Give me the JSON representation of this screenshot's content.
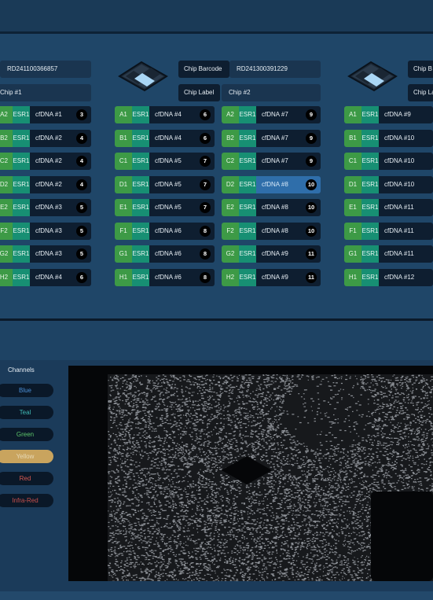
{
  "chips": [
    {
      "barcode_label": "Chip Barcode",
      "barcode": "RD241100366857",
      "label_label": "Chip Label",
      "label": "Chip #1",
      "wells": [
        {
          "pos": "A2",
          "ch": "ESR1",
          "sample": "cfDNA #1",
          "num": "3"
        },
        {
          "pos": "B2",
          "ch": "ESR1",
          "sample": "cfDNA #2",
          "num": "4"
        },
        {
          "pos": "C2",
          "ch": "ESR1",
          "sample": "cfDNA #2",
          "num": "4"
        },
        {
          "pos": "D2",
          "ch": "ESR1",
          "sample": "cfDNA #2",
          "num": "4"
        },
        {
          "pos": "E2",
          "ch": "ESR1",
          "sample": "cfDNA #3",
          "num": "5"
        },
        {
          "pos": "F2",
          "ch": "ESR1",
          "sample": "cfDNA #3",
          "num": "5"
        },
        {
          "pos": "G2",
          "ch": "ESR1",
          "sample": "cfDNA #3",
          "num": "5"
        },
        {
          "pos": "H2",
          "ch": "ESR1",
          "sample": "cfDNA #4",
          "num": "6"
        }
      ]
    },
    {
      "barcode_label": "Chip Barcode",
      "barcode": "RD241300391229",
      "label_label": "Chip Label",
      "label": "Chip #2",
      "wells_col1": [
        {
          "pos": "A1",
          "ch": "ESR1",
          "sample": "cfDNA #4",
          "num": "6"
        },
        {
          "pos": "B1",
          "ch": "ESR1",
          "sample": "cfDNA #4",
          "num": "6"
        },
        {
          "pos": "C1",
          "ch": "ESR1",
          "sample": "cfDNA #5",
          "num": "7"
        },
        {
          "pos": "D1",
          "ch": "ESR1",
          "sample": "cfDNA #5",
          "num": "7"
        },
        {
          "pos": "E1",
          "ch": "ESR1",
          "sample": "cfDNA #5",
          "num": "7"
        },
        {
          "pos": "F1",
          "ch": "ESR1",
          "sample": "cfDNA #6",
          "num": "8"
        },
        {
          "pos": "G1",
          "ch": "ESR1",
          "sample": "cfDNA #6",
          "num": "8"
        },
        {
          "pos": "H1",
          "ch": "ESR1",
          "sample": "cfDNA #6",
          "num": "8"
        }
      ],
      "wells_col2": [
        {
          "pos": "A2",
          "ch": "ESR1",
          "sample": "cfDNA #7",
          "num": "9"
        },
        {
          "pos": "B2",
          "ch": "ESR1",
          "sample": "cfDNA #7",
          "num": "9"
        },
        {
          "pos": "C2",
          "ch": "ESR1",
          "sample": "cfDNA #7",
          "num": "9"
        },
        {
          "pos": "D2",
          "ch": "ESR1",
          "sample": "cfDNA #8",
          "num": "10"
        },
        {
          "pos": "E2",
          "ch": "ESR1",
          "sample": "cfDNA #8",
          "num": "10"
        },
        {
          "pos": "F2",
          "ch": "ESR1",
          "sample": "cfDNA #8",
          "num": "10"
        },
        {
          "pos": "G2",
          "ch": "ESR1",
          "sample": "cfDNA #9",
          "num": "11"
        },
        {
          "pos": "H2",
          "ch": "ESR1",
          "sample": "cfDNA #9",
          "num": "11"
        }
      ]
    },
    {
      "barcode_label": "Chip B",
      "label_label": "Chip La",
      "wells": [
        {
          "pos": "A1",
          "ch": "ESR1",
          "sample": "cfDNA #9"
        },
        {
          "pos": "B1",
          "ch": "ESR1",
          "sample": "cfDNA #10"
        },
        {
          "pos": "C1",
          "ch": "ESR1",
          "sample": "cfDNA #10"
        },
        {
          "pos": "D1",
          "ch": "ESR1",
          "sample": "cfDNA #10"
        },
        {
          "pos": "E1",
          "ch": "ESR1",
          "sample": "cfDNA #11"
        },
        {
          "pos": "F1",
          "ch": "ESR1",
          "sample": "cfDNA #11"
        },
        {
          "pos": "G1",
          "ch": "ESR1",
          "sample": "cfDNA #11"
        },
        {
          "pos": "H1",
          "ch": "ESR1",
          "sample": "cfDNA #12"
        }
      ]
    }
  ],
  "channels": {
    "title": "Channels",
    "items": [
      {
        "label": "Blue",
        "color": "#4a8fd6",
        "active": false
      },
      {
        "label": "Teal",
        "color": "#3fb7b3",
        "active": false
      },
      {
        "label": "Green",
        "color": "#5cc56a",
        "active": false
      },
      {
        "label": "Yellow",
        "color": "#e7d9b7",
        "active": true
      },
      {
        "label": "Red",
        "color": "#d6584f",
        "active": false
      },
      {
        "label": "Infra-Red",
        "color": "#c8504c",
        "active": false
      }
    ]
  },
  "selected_well": "D2"
}
